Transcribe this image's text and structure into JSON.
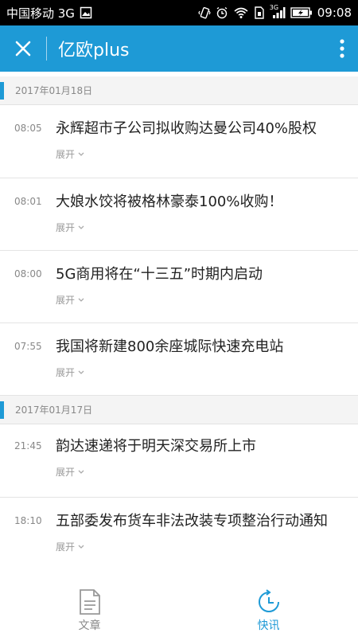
{
  "status_bar": {
    "carrier": "中国移动 3G",
    "network_small": "3G",
    "time": "09:08"
  },
  "app_bar": {
    "title": "亿欧plus"
  },
  "sections": [
    {
      "date": "2017年01月18日",
      "items": [
        {
          "time": "08:05",
          "title": "永辉超市子公司拟收购达曼公司40%股权",
          "expand": "展开"
        },
        {
          "time": "08:01",
          "title": "大娘水饺将被格林豪泰100%收购！",
          "expand": "展开"
        },
        {
          "time": "08:00",
          "title": "5G商用将在“十三五”时期内启动",
          "expand": "展开"
        },
        {
          "time": "07:55",
          "title": "我国将新建800余座城际快速充电站",
          "expand": "展开"
        }
      ]
    },
    {
      "date": "2017年01月17日",
      "items": [
        {
          "time": "21:45",
          "title": "韵达速递将于明天深交易所上市",
          "expand": "展开"
        },
        {
          "time": "18:10",
          "title": "五部委发布货车非法改装专项整治行动通知",
          "expand": "展开"
        }
      ]
    }
  ],
  "tab_bar": {
    "tabs": [
      {
        "label": "文章",
        "icon": "document-icon",
        "active": false
      },
      {
        "label": "快讯",
        "icon": "clock-refresh-icon",
        "active": true
      }
    ]
  },
  "colors": {
    "accent": "#1e9ad6",
    "status_bar_bg": "#000000",
    "section_bg": "#f4f4f4",
    "inactive_tab": "#888888"
  }
}
